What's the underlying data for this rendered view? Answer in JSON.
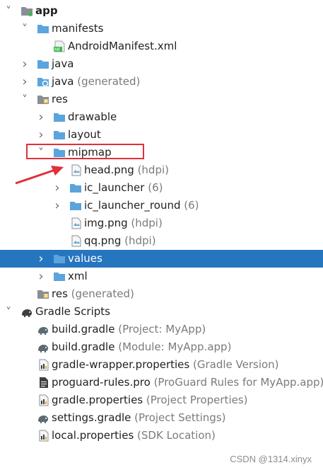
{
  "tree": [
    {
      "depth": 0,
      "expand": "down",
      "icon": "module-folder-icon",
      "label": "app",
      "bold": true
    },
    {
      "depth": 1,
      "expand": "down",
      "icon": "folder-icon",
      "label": "manifests"
    },
    {
      "depth": 2,
      "expand": "none",
      "icon": "manifest-file-icon",
      "label": "AndroidManifest.xml"
    },
    {
      "depth": 1,
      "expand": "right",
      "icon": "java-folder-icon",
      "label": "java"
    },
    {
      "depth": 1,
      "expand": "right",
      "icon": "generated-java-folder-icon",
      "label": "java",
      "sub": "(generated)"
    },
    {
      "depth": 1,
      "expand": "down",
      "icon": "resource-folder-icon",
      "label": "res"
    },
    {
      "depth": 2,
      "expand": "right",
      "icon": "folder-icon",
      "label": "drawable"
    },
    {
      "depth": 2,
      "expand": "right",
      "icon": "folder-icon",
      "label": "layout"
    },
    {
      "depth": 2,
      "expand": "down",
      "icon": "folder-icon",
      "label": "mipmap"
    },
    {
      "depth": 3,
      "expand": "none",
      "icon": "image-file-icon",
      "label": "head.png",
      "sub": "(hdpi)"
    },
    {
      "depth": 3,
      "expand": "right",
      "icon": "folder-icon",
      "label": "ic_launcher",
      "sub": "(6)"
    },
    {
      "depth": 3,
      "expand": "right",
      "icon": "folder-icon",
      "label": "ic_launcher_round",
      "sub": "(6)"
    },
    {
      "depth": 3,
      "expand": "none",
      "icon": "image-file-icon",
      "label": "img.png",
      "sub": "(hdpi)"
    },
    {
      "depth": 3,
      "expand": "none",
      "icon": "image-file-icon",
      "label": "qq.png",
      "sub": "(hdpi)"
    },
    {
      "depth": 2,
      "expand": "right",
      "icon": "folder-icon",
      "label": "values",
      "selected": true
    },
    {
      "depth": 2,
      "expand": "right",
      "icon": "folder-icon",
      "label": "xml"
    },
    {
      "depth": 1,
      "expand": "none",
      "icon": "resource-folder-icon",
      "label": "res",
      "sub": "(generated)"
    },
    {
      "depth": 0,
      "expand": "down",
      "icon": "gradle-elephant-icon",
      "label": "Gradle Scripts"
    },
    {
      "depth": 1,
      "expand": "none",
      "icon": "gradle-file-icon",
      "label": "build.gradle",
      "sub": "(Project: MyApp)"
    },
    {
      "depth": 1,
      "expand": "none",
      "icon": "gradle-file-icon",
      "label": "build.gradle",
      "sub": "(Module: MyApp.app)"
    },
    {
      "depth": 1,
      "expand": "none",
      "icon": "properties-file-icon",
      "label": "gradle-wrapper.properties",
      "sub": "(Gradle Version)"
    },
    {
      "depth": 1,
      "expand": "none",
      "icon": "text-file-icon",
      "label": "proguard-rules.pro",
      "sub": "(ProGuard Rules for MyApp.app)"
    },
    {
      "depth": 1,
      "expand": "none",
      "icon": "properties-file-icon",
      "label": "gradle.properties",
      "sub": "(Project Properties)"
    },
    {
      "depth": 1,
      "expand": "none",
      "icon": "gradle-file-icon",
      "label": "settings.gradle",
      "sub": "(Project Settings)"
    },
    {
      "depth": 1,
      "expand": "none",
      "icon": "properties-file-icon",
      "label": "local.properties",
      "sub": "(SDK Location)"
    }
  ],
  "colors": {
    "selection": "#2675bf",
    "folder": "#5ba4dc",
    "annotation": "#e0303a"
  },
  "watermark": "CSDN @1314.xinyx"
}
